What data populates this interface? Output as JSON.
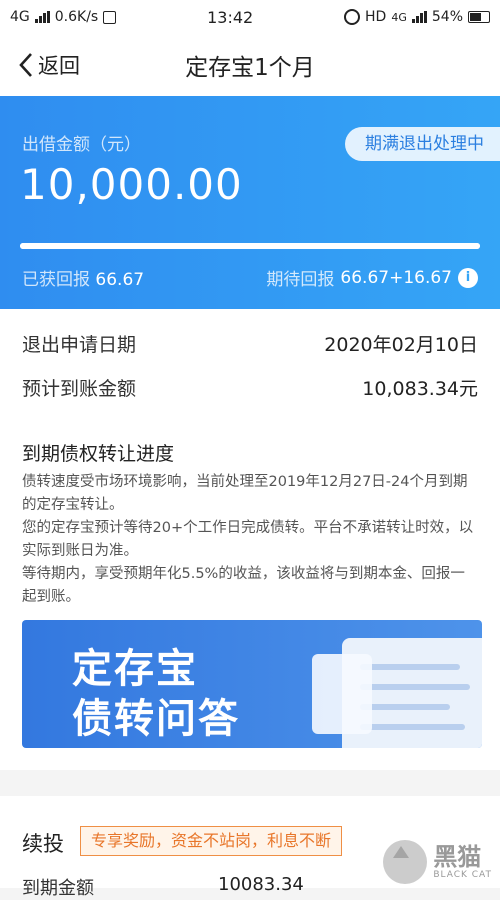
{
  "status_bar": {
    "network": "4G",
    "speed": "0.6K/s",
    "time": "13:42",
    "hd": "HD",
    "network_right": "4G",
    "battery": "54%"
  },
  "nav": {
    "back_label": "返回",
    "title": "定存宝1个月"
  },
  "hero": {
    "amount_label": "出借金额（元）",
    "amount": "10,000.00",
    "badge": "期满退出处理中",
    "progress": 1.0,
    "earned_label": "已获回报",
    "earned_value": "66.67",
    "expected_label": "期待回报",
    "expected_value": "66.67+16.67",
    "accent": "#2f8df0"
  },
  "details": {
    "exit_date_label": "退出申请日期",
    "exit_date_value": "2020年02月10日",
    "arrival_label": "预计到账金额",
    "arrival_value": "10,083.34元"
  },
  "progress_section": {
    "title": "到期债权转让进度",
    "lines": [
      "债转速度受市场环境影响，当前处理至2019年12月27日-24个月到期的定存宝转让。",
      "您的定存宝预计等待20+个工作日完成债转。平台不承诺转让时效，以实际到账日为准。",
      "等待期内，享受预期年化5.5%的收益，该收益将与到期本金、回报一起到账。"
    ]
  },
  "banner": {
    "line1": "定存宝",
    "line2": "债转问答"
  },
  "reinvest": {
    "title": "续投",
    "tag": "专享奖励，资金不站岗，利息不断",
    "due_label": "到期金额",
    "due_value": "10083.34"
  },
  "watermark": {
    "text": "黑猫",
    "sub": "BLACK CAT"
  }
}
